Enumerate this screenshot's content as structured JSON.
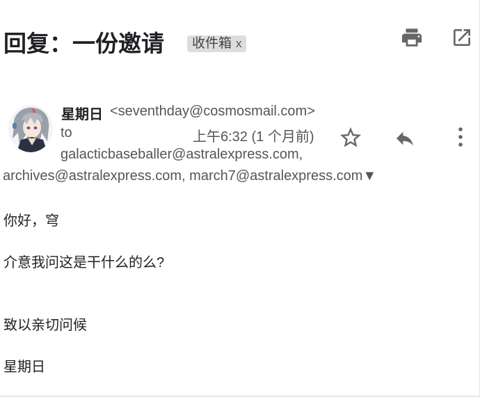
{
  "email": {
    "subject": "回复：一份邀请",
    "label_chip": "收件箱",
    "label_chip_close": "x",
    "sender": {
      "name": "星期日",
      "email": "<seventhday@cosmosmail.com>"
    },
    "to_label": "to",
    "timestamp": "上午6:32 (1 个月前)",
    "recipients_line1": "galacticbaseballer@astralexpress.com,",
    "recipients_line2": "archives@astralexpress.com, march7@astralexpress.com▼",
    "body": {
      "greeting": "你好，穹",
      "question": "介意我问这是干什么的么?",
      "closing": "致以亲切问候",
      "signature": "星期日"
    }
  },
  "icons": {
    "print": "print-icon",
    "popout": "open-in-new-window-icon",
    "star": "star-icon",
    "reply": "reply-icon",
    "more": "more-vert-icon"
  },
  "colors": {
    "icon_gray": "#666666",
    "text_primary": "#202124",
    "text_secondary": "#555555",
    "chip_bg": "#dddddd"
  }
}
